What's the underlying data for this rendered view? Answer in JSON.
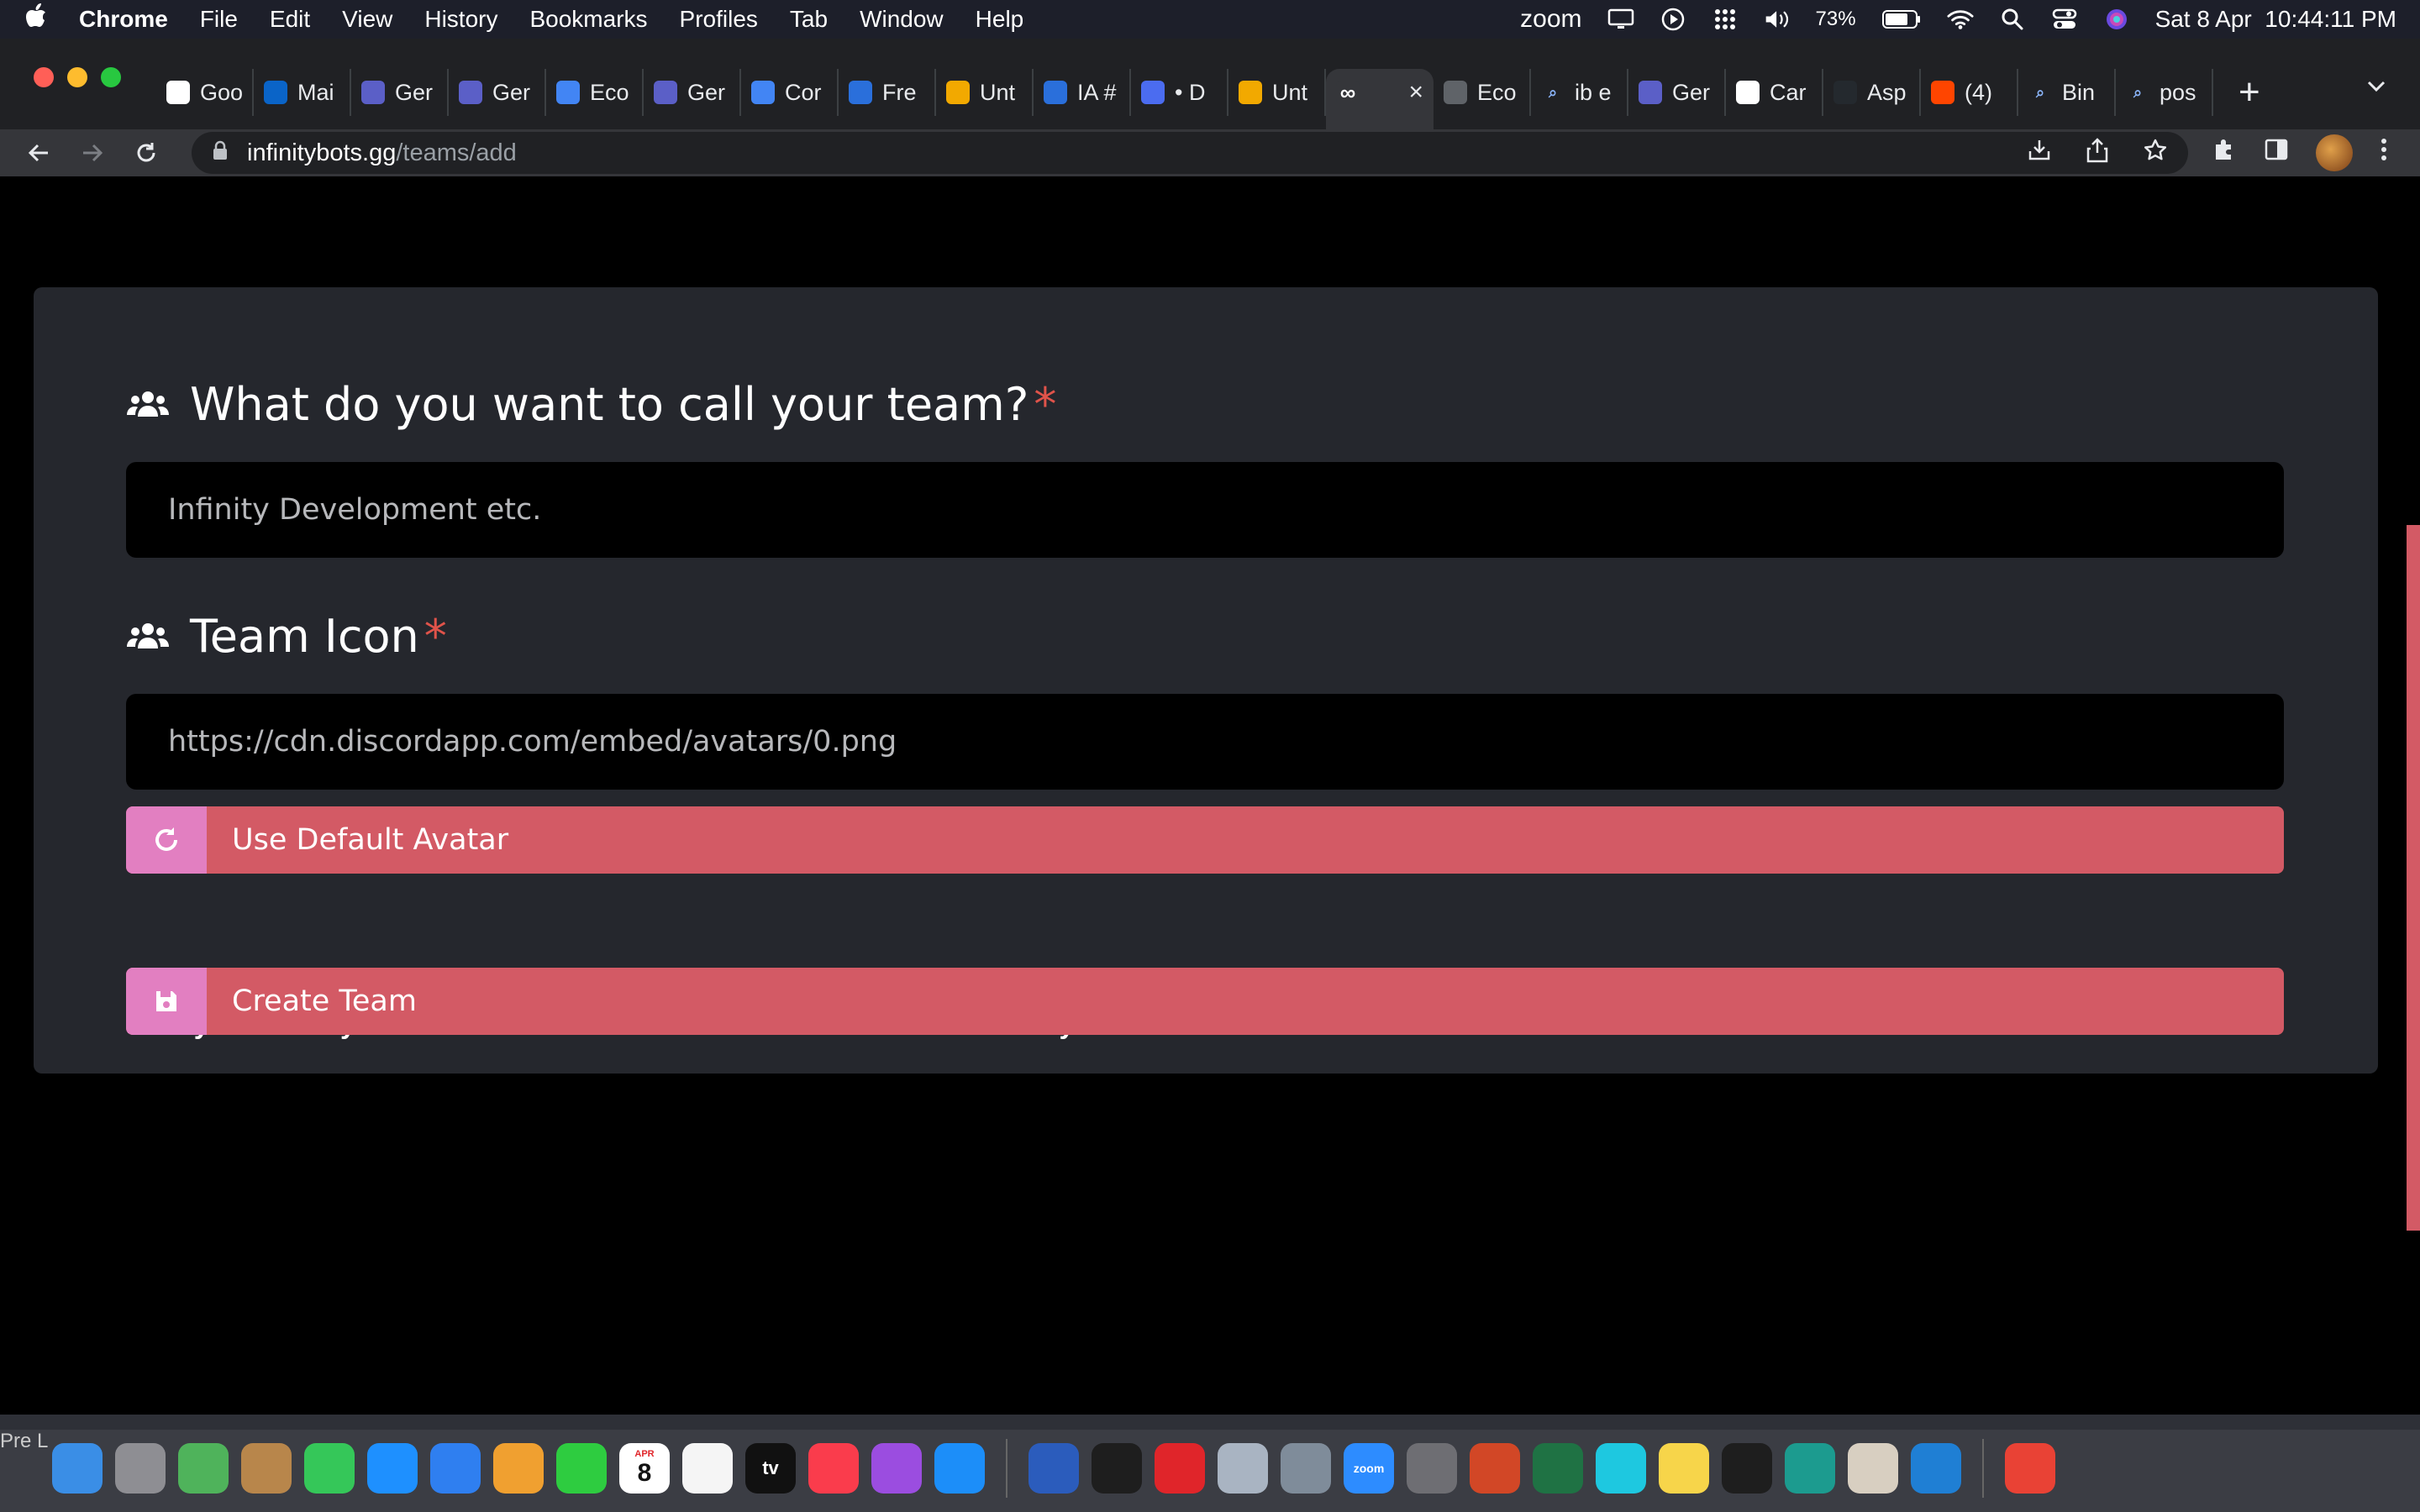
{
  "menubar": {
    "app_name": "Chrome",
    "menus": [
      "File",
      "Edit",
      "View",
      "History",
      "Bookmarks",
      "Profiles",
      "Tab",
      "Window",
      "Help"
    ],
    "zoom_label": "zoom",
    "battery": "73%",
    "datetime": "Sat 8 Apr  10:44:11 PM"
  },
  "tabs": [
    {
      "label": "Goo",
      "icon": "google-icon",
      "color": "#ffffff"
    },
    {
      "label": "Mai",
      "icon": "outlook-icon",
      "color": "#0a64c8"
    },
    {
      "label": "Ger",
      "icon": "teams-icon",
      "color": "#5b5fc7"
    },
    {
      "label": "Ger",
      "icon": "teams-icon",
      "color": "#5b5fc7"
    },
    {
      "label": "Eco",
      "icon": "docs-icon",
      "color": "#4285f4"
    },
    {
      "label": "Ger",
      "icon": "teams-icon",
      "color": "#5b5fc7"
    },
    {
      "label": "Cor",
      "icon": "docs-icon",
      "color": "#4285f4"
    },
    {
      "label": "Fre",
      "icon": "c-icon",
      "color": "#2a6fdb"
    },
    {
      "label": "Unt",
      "icon": "warning-icon",
      "color": "#f2a900"
    },
    {
      "label": "IA #",
      "icon": "c-icon",
      "color": "#2a6fdb"
    },
    {
      "label": "• D",
      "icon": "grammarly-icon",
      "color": "#4b6cf0"
    },
    {
      "label": "Unt",
      "icon": "warning-icon",
      "color": "#f2a900"
    },
    {
      "label": "",
      "icon": "infinity-icon",
      "color": "#35363a",
      "active": true
    },
    {
      "label": "Eco",
      "icon": "globe-icon",
      "color": "#5f6368"
    },
    {
      "label": "ib e",
      "icon": "search-icon",
      "color": "#1a73e8"
    },
    {
      "label": "Ger",
      "icon": "teams-icon",
      "color": "#5b5fc7"
    },
    {
      "label": "Car",
      "icon": "wikipedia-icon",
      "color": "#ffffff"
    },
    {
      "label": "Asp",
      "icon": "github-icon",
      "color": "#24292e"
    },
    {
      "label": "(4)",
      "icon": "reddit-icon",
      "color": "#ff4500"
    },
    {
      "label": "Bin",
      "icon": "search-icon",
      "color": "#1a73e8"
    },
    {
      "label": "pos",
      "icon": "search-icon",
      "color": "#1a73e8"
    }
  ],
  "toolbar": {
    "url_host": "infinitybots.gg",
    "url_path": "/teams/add"
  },
  "form": {
    "name_label": "What do you want to call your team?",
    "name_placeholder": "Infinity Development etc.",
    "icon_label": "Team Icon",
    "icon_value": "https://cdn.discordapp.com/embed/avatars/0.png",
    "required_mark": "*",
    "default_avatar_button": "Use Default Avatar",
    "ready_note": "Ready to create your team? You'll be able to add members and bots to your team once it's created.",
    "create_button": "Create Team"
  },
  "colors": {
    "button_bg": "#d35a65",
    "button_icon_bg": "#e27fc1",
    "card_bg": "#25272d",
    "required": "#e0534a"
  },
  "dock": {
    "left_label": "Pre L",
    "calendar_day": "8",
    "calendar_month": "APR",
    "tv_label": "tv",
    "zoom_label": "zoom",
    "apps": [
      {
        "name": "finder-icon",
        "color": "#3a8ee6"
      },
      {
        "name": "launchpad-icon",
        "color": "#8e8e93"
      },
      {
        "name": "maps-icon",
        "color": "#4fb35b"
      },
      {
        "name": "contacts-icon",
        "color": "#b8864b"
      },
      {
        "name": "messages-icon",
        "color": "#35c759"
      },
      {
        "name": "safari-icon",
        "color": "#1e90ff"
      },
      {
        "name": "mail-icon",
        "color": "#2f7ff0"
      },
      {
        "name": "photos-icon",
        "color": "#f0a030"
      },
      {
        "name": "facetime-icon",
        "color": "#2ecc40"
      },
      {
        "name": "calendar-icon",
        "color": "#ffffff"
      },
      {
        "name": "reminders-icon",
        "color": "#f5f5f5"
      },
      {
        "name": "apple-tv-icon",
        "color": "#111111"
      },
      {
        "name": "music-icon",
        "color": "#fa3c4c"
      },
      {
        "name": "podcasts-icon",
        "color": "#9b4de0"
      },
      {
        "name": "app-store-icon",
        "color": "#1c8ef9"
      },
      {
        "name": "word-icon",
        "color": "#2b5cbc"
      },
      {
        "name": "terminal-icon",
        "color": "#1e1e1e"
      },
      {
        "name": "creative-cloud-icon",
        "color": "#e0252a"
      },
      {
        "name": "preview-icon",
        "color": "#a9b4c2"
      },
      {
        "name": "system-info-icon",
        "color": "#7f8c9a"
      },
      {
        "name": "zoom-icon",
        "color": "#2d8cff"
      },
      {
        "name": "system-preferences-icon",
        "color": "#6e6e73"
      },
      {
        "name": "powerpoint-icon",
        "color": "#d24726"
      },
      {
        "name": "excel-icon",
        "color": "#1f7244"
      },
      {
        "name": "clock-icon",
        "color": "#1ec8e0"
      },
      {
        "name": "notes-icon",
        "color": "#f7d54a"
      },
      {
        "name": "activity-monitor-icon",
        "color": "#1e1e1e"
      },
      {
        "name": "edge-dev-icon",
        "color": "#1c9b8f"
      },
      {
        "name": "cyberduck-icon",
        "color": "#d8cfc1"
      },
      {
        "name": "vscode-icon",
        "color": "#1f7fd4"
      },
      {
        "name": "chrome-icon",
        "color": "#e94235"
      }
    ]
  }
}
